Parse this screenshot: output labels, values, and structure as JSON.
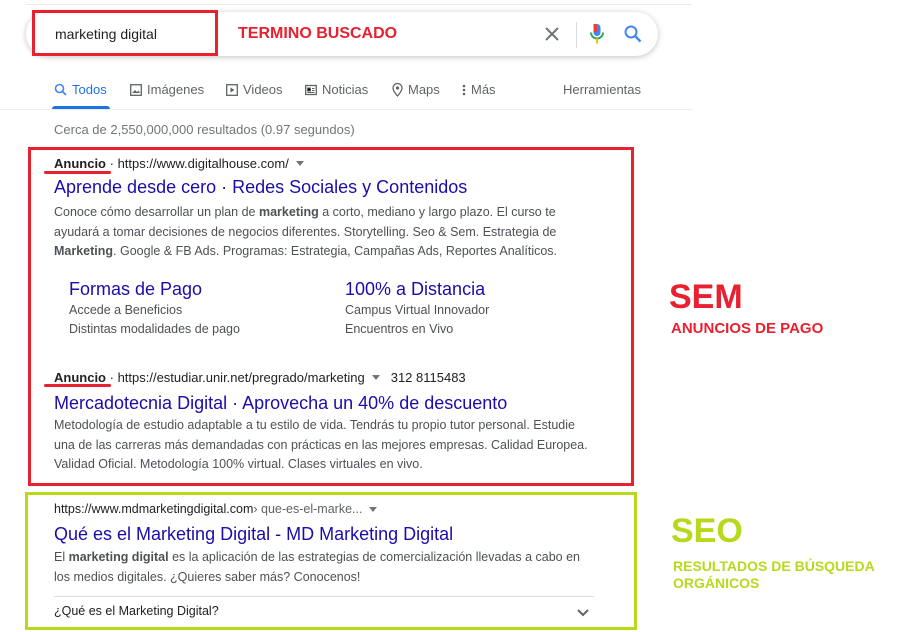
{
  "search": {
    "query": "marketing digital",
    "annotation": "TERMINO BUSCADO"
  },
  "tabs": [
    {
      "label": "Todos",
      "icon": "search-icon"
    },
    {
      "label": "Imágenes",
      "icon": "image-icon"
    },
    {
      "label": "Videos",
      "icon": "play-icon"
    },
    {
      "label": "Noticias",
      "icon": "news-icon"
    },
    {
      "label": "Maps",
      "icon": "map-pin-icon"
    },
    {
      "label": "Más",
      "icon": "more-vert-icon"
    }
  ],
  "tools_label": "Herramientas",
  "result_stats": "Cerca de 2,550,000,000 resultados (0.97 segundos)",
  "ads": [
    {
      "badge": "Anuncio",
      "url": "https://www.digitalhouse.com/",
      "title": "Aprende desde cero · Redes Sociales y Contenidos",
      "snippet_parts": [
        {
          "t": "Conoce cómo desarrollar un plan de "
        },
        {
          "t": "marketing",
          "b": true
        },
        {
          "t": " a corto, mediano y largo plazo. El curso te ayudará a tomar decisiones de negocios diferentes. Storytelling. Seo & Sem. Estrategia de "
        },
        {
          "t": "Marketing",
          "b": true
        },
        {
          "t": ". Google & FB Ads. Programas: Estrategia, Campañas Ads, Reportes Analíticos."
        }
      ],
      "sitelinks": [
        {
          "title": "Formas de Pago",
          "lines": [
            "Accede a Beneficios",
            "Distintas modalidades de pago"
          ]
        },
        {
          "title": "100% a Distancia",
          "lines": [
            "Campus Virtual Innovador",
            "Encuentros en Vivo"
          ]
        }
      ]
    },
    {
      "badge": "Anuncio",
      "url": "https://estudiar.unir.net/pregrado/marketing",
      "phone": "312 8115483",
      "title": "Mercadotecnia Digital · Aprovecha un 40% de descuento",
      "snippet": "Metodología de estudio adaptable a tu estilo de vida. Tendrás tu propio tutor personal. Estudie una de las carreras más demandadas con prácticas en las mejores empresas. Calidad Europea. Validad Oficial. Metodología 100% virtual. Clases virtuales en vivo."
    }
  ],
  "organic": {
    "url": "https://www.mdmarketingdigital.com",
    "url_path": " › que-es-el-marke...",
    "title": "Qué es el Marketing Digital - MD Marketing Digital",
    "snippet_parts": [
      {
        "t": "El "
      },
      {
        "t": "marketing digital",
        "b": true
      },
      {
        "t": " es la aplicación de las estrategias de comercialización llevadas a cabo en los medios digitales. ¿Quieres saber más? Conocenos!"
      }
    ],
    "faq": "¿Qué es el Marketing Digital?"
  },
  "labels": {
    "sem": "SEM",
    "sem_sub": "ANUNCIOS DE PAGO",
    "seo": "SEO",
    "seo_sub": "RESULTADOS DE BÚSQUEDA ORGÁNICOS"
  },
  "colors": {
    "sem": "#e8202f",
    "seo": "#b6da1b",
    "link": "#1a0dab",
    "accent": "#1a73e8"
  }
}
